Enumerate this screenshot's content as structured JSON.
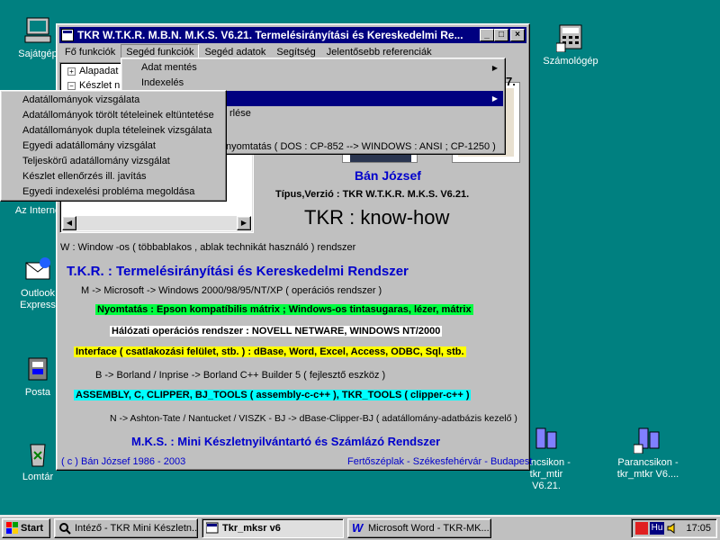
{
  "desktop_icons": {
    "my_computer": "Sajátgép",
    "internet": "Az Interne",
    "outlook": "Outlook Express",
    "post": "Posta",
    "recycle": "Lomtár",
    "calculator": "Számológép",
    "shortcut1": "rancsikon - tkr_mtir V6.21.",
    "shortcut2": "Parancsikon - tkr_mtkr V6...."
  },
  "window": {
    "title": "TKR W.T.K.R. M.B.N. M.K.S. V6.21. Termelésirányítási és Kereskedelmi Re...",
    "min": "_",
    "max": "□",
    "close": "×"
  },
  "menubar": [
    "Fő funkciók",
    "Segéd funkciók",
    "Segéd adatok",
    "Segítség",
    "Jelentősebb referenciák"
  ],
  "tree": {
    "item1": "Alapadat",
    "item2": "Készlet n"
  },
  "submenu1": {
    "items": [
      "Adat mentés",
      "Indexelés",
      "",
      ""
    ],
    "partial1": "rlése",
    "partial2": "nyomtatás  ( DOS : CP-852 --> WINDOWS : ANSI ; CP-1250 )"
  },
  "submenu2": {
    "items": [
      "Adatállományok vizsgálata",
      "Adatállományok törölt tételeinek eltüntetése",
      "Adatállományok dupla tételeinek vizsgálata",
      "Egyedi adatállomány vizsgálat",
      "Teljeskörű adatállomány vizsgálat",
      "Készlet ellenőrzés ill. javítás",
      "Egyedi indexelési probléma megoldása"
    ]
  },
  "content": {
    "fragment7": "7.",
    "author": "Bán József",
    "type_version": "Típus,Verzió : TKR W.T.K.R. M.K.S. V6.21.",
    "knowhow": "TKR :  know-how",
    "w_line": "W : Window -os ( többablakos , ablak technikát használó ) rendszer",
    "tkr_title": "T.K.R. : Termelésirányítási és Kereskedelmi Rendszer",
    "m_line": "M -> Microsoft -> Windows 2000/98/95/NT/XP       ( operációs rendszer )",
    "print_line": "Nyomtatás : Epson kompatíbilis mátrix ;  Windows-os tintasugaras, lézer, mátrix",
    "network_line": "Hálózati operációs rendszer : NOVELL NETWARE, WINDOWS NT/2000",
    "interface_line": "Interface ( csatlakozási felület, stb. )  : dBase, Word, Excel, Access, ODBC, Sql, stb.",
    "b_line": "B -> Borland / Inprise -> Borland C++ Builder 5      ( fejlesztő eszköz )",
    "asm_line": "ASSEMBLY, C, CLIPPER, BJ_TOOLS ( assembly-c-c++ ), TKR_TOOLS ( clipper-c++ )",
    "n_line": "N -> Ashton-Tate / Nantucket / VISZK - BJ -> dBase-Clipper-BJ    ( adatállomány-adatbázis kezelő )",
    "mks_line": "M.K.S. : Mini Készletnyilvántartó és Számlázó Rendszer",
    "copyright": "( c ) Bán József 1986 - 2003",
    "location": "Fertőszéplak - Székesfehérvár - Budapest"
  },
  "taskbar": {
    "start": "Start",
    "tasks": [
      "Intéző - TKR Mini Készletn...",
      "Tkr_mksr v6",
      "Microsoft Word - TKR-MK..."
    ],
    "lang": "Hu",
    "clock": "17:05"
  },
  "colors": {
    "desktop": "#008080",
    "titlebar": "#000080",
    "green": "#00ff40",
    "yellow": "#ffff00",
    "cyan": "#00ffff",
    "blue_text": "#0000cc"
  }
}
